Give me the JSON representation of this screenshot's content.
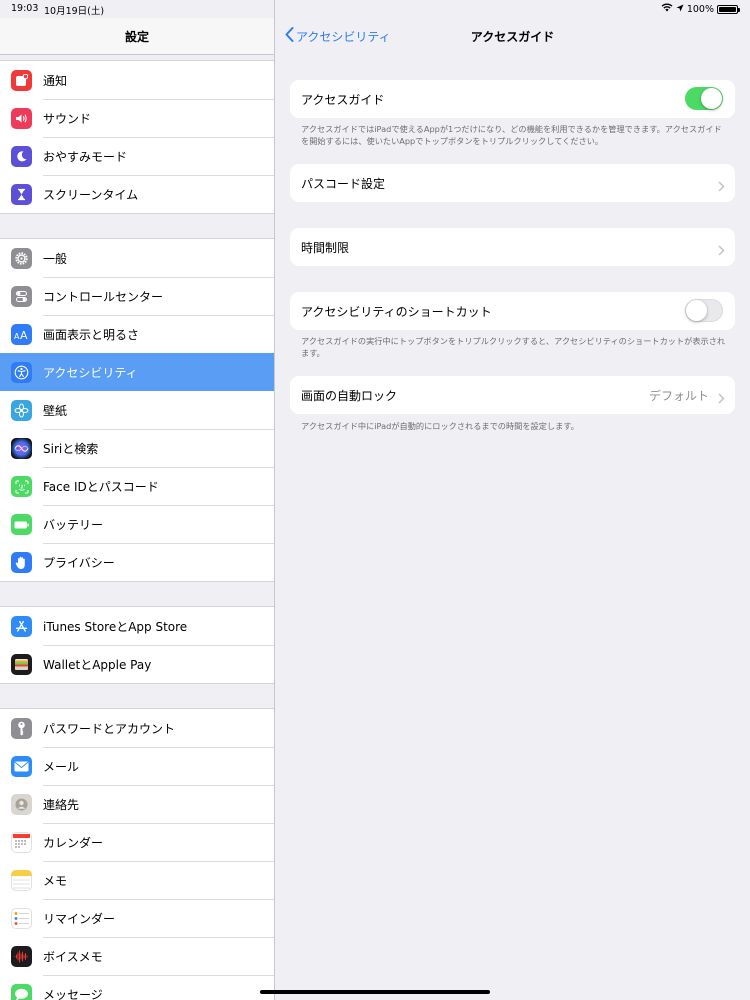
{
  "status_bar": {
    "time": "19:03",
    "date": "10月19日(土)",
    "battery": "100%",
    "battery_level": 1.0
  },
  "sidebar": {
    "title": "設定",
    "groups": [
      {
        "items": [
          {
            "label": "通知",
            "icon": "notifications-icon",
            "color": "#f03a3a"
          },
          {
            "label": "サウンド",
            "icon": "sound-icon",
            "color": "#ee3b5b"
          },
          {
            "label": "おやすみモード",
            "icon": "moon-icon",
            "color": "#5b50d6"
          },
          {
            "label": "スクリーンタイム",
            "icon": "hourglass-icon",
            "color": "#5b50d6"
          }
        ]
      },
      {
        "items": [
          {
            "label": "一般",
            "icon": "gear-icon",
            "color": "#8e8e93"
          },
          {
            "label": "コントロールセンター",
            "icon": "switches-icon",
            "color": "#8e8e93"
          },
          {
            "label": "画面表示と明るさ",
            "icon": "text-size-icon",
            "color": "#2f7cf6"
          },
          {
            "label": "アクセシビリティ",
            "icon": "accessibility-icon",
            "color": "#2f7cf6",
            "selected": true
          },
          {
            "label": "壁紙",
            "icon": "flower-icon",
            "color": "#3aa6e0"
          },
          {
            "label": "Siriと検索",
            "icon": "siri-icon",
            "color": "#222222"
          },
          {
            "label": "Face IDとパスコード",
            "icon": "face-id-icon",
            "color": "#4cd964"
          },
          {
            "label": "バッテリー",
            "icon": "battery-icon",
            "color": "#4cd964"
          },
          {
            "label": "プライバシー",
            "icon": "hand-icon",
            "color": "#2f7cf6"
          }
        ]
      },
      {
        "items": [
          {
            "label": "iTunes StoreとApp Store",
            "icon": "app-store-icon",
            "color": "#2f8cf6"
          },
          {
            "label": "WalletとApple Pay",
            "icon": "wallet-icon",
            "color": "#1c1c1e"
          }
        ]
      },
      {
        "items": [
          {
            "label": "パスワードとアカウント",
            "icon": "key-icon",
            "color": "#8e8e93"
          },
          {
            "label": "メール",
            "icon": "mail-icon",
            "color": "#2f8cf6"
          },
          {
            "label": "連絡先",
            "icon": "contacts-icon",
            "color": "#c8c6c2"
          },
          {
            "label": "カレンダー",
            "icon": "calendar-icon",
            "color": "#ffffff"
          },
          {
            "label": "メモ",
            "icon": "notes-icon",
            "color": "#f7cd46"
          },
          {
            "label": "リマインダー",
            "icon": "reminders-icon",
            "color": "#ffffff"
          },
          {
            "label": "ボイスメモ",
            "icon": "voice-memo-icon",
            "color": "#1c1c1e"
          },
          {
            "label": "メッセージ",
            "icon": "messages-icon",
            "color": "#4cd964"
          }
        ]
      }
    ]
  },
  "detail": {
    "back_label": "アクセシビリティ",
    "title": "アクセスガイド",
    "guided_access": {
      "label": "アクセスガイド",
      "on": true
    },
    "guided_access_note": "アクセスガイドではiPadで使えるAppが1つだけになり、どの機能を利用できるかを管理できます。アクセスガイドを開始するには、使いたいAppでトップボタンをトリプルクリックしてください。",
    "passcode_label": "パスコード設定",
    "time_limits_label": "時間制限",
    "shortcut": {
      "label": "アクセシビリティのショートカット",
      "on": false
    },
    "shortcut_note": "アクセスガイドの実行中にトップボタンをトリプルクリックすると、アクセシビリティのショートカットが表示されます。",
    "auto_lock": {
      "label": "画面の自動ロック",
      "value": "デフォルト"
    },
    "auto_lock_note": "アクセスガイド中にiPadが自動的にロックされるまでの時間を設定します。"
  }
}
